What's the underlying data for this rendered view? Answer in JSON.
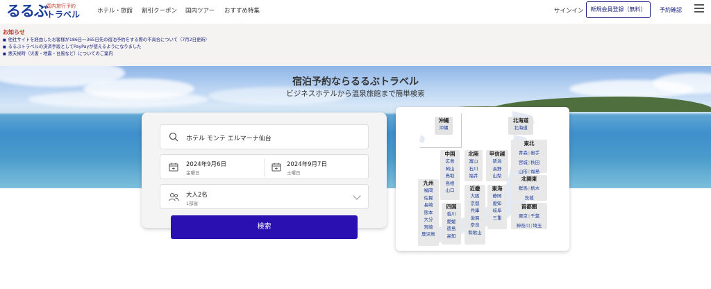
{
  "header": {
    "logo_main": "るるぶ",
    "logo_tagline": "国内旅行予約",
    "logo_sub": "トラベル",
    "nav": [
      "ホテル・旅館",
      "割引クーポン",
      "国内ツアー",
      "おすすめ特集"
    ],
    "signin": "サインイン",
    "register": "新規会員登録（無料）",
    "reservation_check": "予約確認"
  },
  "notice": {
    "title": "お知らせ",
    "items": [
      "他社サイトを経由したお客様が186日～365日先の宿泊予約をする際の不具合について（7月2日更新）",
      "るるぶトラベルの決済手段としてPayPayが使えるようになりました",
      "悪天候時（災害・地震・台風など）についてのご案内"
    ]
  },
  "hero": {
    "title": "宿泊予約ならるるぶトラベル",
    "subtitle": "ビジネスホテルから温泉旅館まで簡単検索"
  },
  "search": {
    "hotel": "ホテル モンテ エルマーナ仙台",
    "checkin_date": "2024年9月6日",
    "checkin_day": "金曜日",
    "checkout_date": "2024年9月7日",
    "checkout_day": "土曜日",
    "guests": "大人2名",
    "rooms": "1部屋",
    "button": "検索"
  },
  "map": {
    "okinawa": {
      "name": "沖縄",
      "prefs": [
        "沖縄"
      ]
    },
    "hokkaido": {
      "name": "北海道",
      "prefs": [
        "北海道"
      ]
    },
    "tohoku": {
      "name": "東北",
      "rows": [
        [
          "青森",
          "岩手"
        ],
        [
          "宮城",
          "秋田"
        ],
        [
          "山形",
          "福島"
        ]
      ]
    },
    "kitakanto": {
      "name": "北関東",
      "rows": [
        [
          "群馬",
          "栃木"
        ],
        [
          "茨城"
        ]
      ]
    },
    "shutoken": {
      "name": "首都圏",
      "rows": [
        [
          "東京",
          "千葉"
        ],
        [
          "神奈川",
          "埼玉"
        ]
      ]
    },
    "chugoku": {
      "name": "中国",
      "prefs": [
        "広島",
        "岡山",
        "鳥取",
        "島根",
        "山口"
      ]
    },
    "hokuriku": {
      "name": "北陸",
      "prefs": [
        "富山",
        "石川",
        "福井"
      ]
    },
    "koshinetsu": {
      "name": "甲信越",
      "prefs": [
        "新潟",
        "長野",
        "山梨"
      ]
    },
    "kinki": {
      "name": "近畿",
      "prefs": [
        "大阪",
        "京都",
        "兵庫",
        "滋賀",
        "奈良",
        "和歌山"
      ]
    },
    "tokai": {
      "name": "東海",
      "prefs": [
        "静岡",
        "愛知",
        "岐阜",
        "三重"
      ]
    },
    "shikoku": {
      "name": "四国",
      "prefs": [
        "香川",
        "愛媛",
        "徳島",
        "高知"
      ]
    },
    "kyushu": {
      "name": "九州",
      "prefs": [
        "福岡",
        "佐賀",
        "長崎",
        "熊本",
        "大分",
        "宮崎",
        "鹿児島"
      ]
    }
  }
}
